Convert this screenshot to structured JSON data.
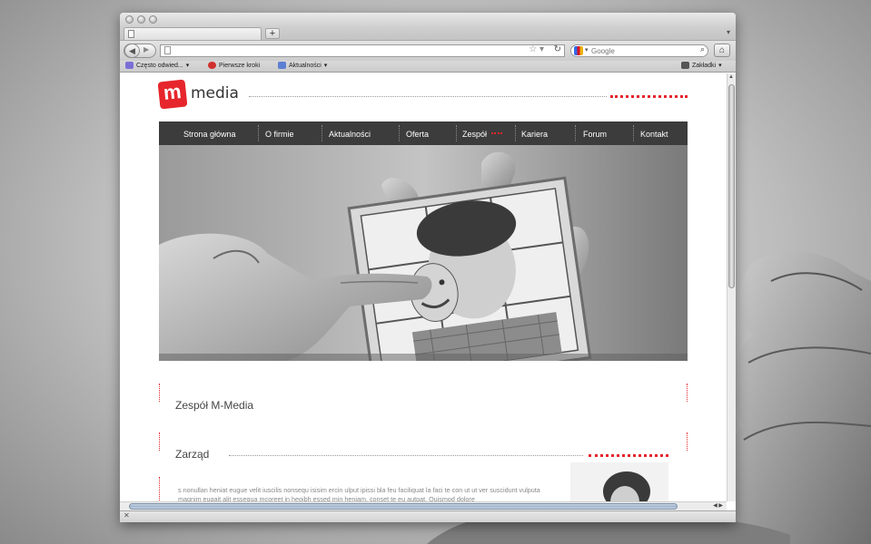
{
  "browser": {
    "search_placeholder": "Google",
    "bookmarks": [
      {
        "label": "Często odwied...",
        "icon": "bookmarks-folder-icon",
        "has_menu": true
      },
      {
        "label": "Pierwsze kroki",
        "icon": "firefox-icon",
        "has_menu": false
      },
      {
        "label": "Aktualności",
        "icon": "rss-icon",
        "has_menu": true
      }
    ],
    "bookmarks_menu_label": "Zakładki"
  },
  "site": {
    "logo_letter": "m",
    "logo_text": "media",
    "menu": [
      "Strona główna",
      "O firmie",
      "Aktualności",
      "Oferta",
      "Zespół",
      "Kariera",
      "Forum",
      "Kontakt"
    ],
    "active_menu_item": "Zespół",
    "section_title": "Zespół M-Media",
    "subsection_title": "Zarząd",
    "body_text": "s nonullan heniat eugue velit iuscilis nonsequ isisim ercin ulput ipissi bla feu faciliquat la faci te con ut ut ver suscidunt vulputa magnim eugait alit essequa mcoreet in heoibh essed min heniam, conset te eu autpat. Quismod dolore",
    "accent_color": "#e6262c"
  }
}
